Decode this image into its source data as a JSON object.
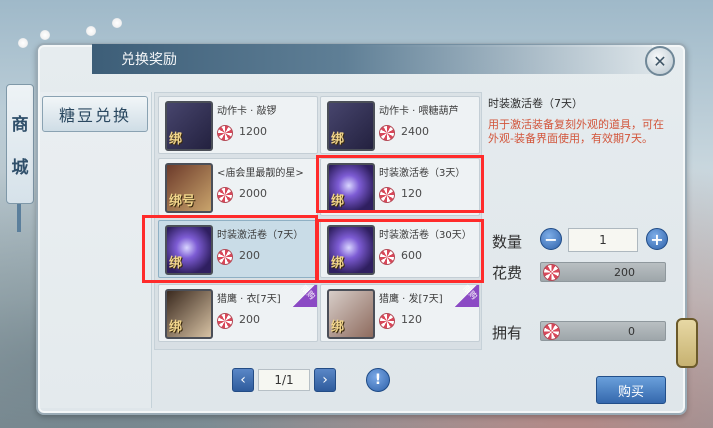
{
  "window": {
    "title": "兑换奖励",
    "close_symbol": "✕"
  },
  "side_banner": {
    "chars": [
      "商",
      "城"
    ]
  },
  "side_tab": {
    "label": "糖豆兑换"
  },
  "items": [
    {
      "name": "动作卡 · 敲锣",
      "price": "1200",
      "bind": "绑",
      "thumb": "book"
    },
    {
      "name": "动作卡 · 喂糖葫芦",
      "price": "2400",
      "bind": "绑",
      "thumb": "book"
    },
    {
      "name": "<庙会里最靓的星>",
      "price": "2000",
      "bind": "绑号",
      "thumb": "star"
    },
    {
      "name": "时装激活卷（3天）",
      "price": "120",
      "bind": "绑",
      "thumb": "scroll"
    },
    {
      "name": "时装激活卷（7天）",
      "price": "200",
      "bind": "绑",
      "thumb": "scroll",
      "selected": true
    },
    {
      "name": "时装激活卷（30天）",
      "price": "600",
      "bind": "绑",
      "thumb": "scroll"
    },
    {
      "name": "猎鹰 · 衣[7天]",
      "price": "200",
      "bind": "绑",
      "thumb": "hawk",
      "limited": "限购"
    },
    {
      "name": "猎鹰 · 发[7天]",
      "price": "120",
      "bind": "绑",
      "thumb": "hair",
      "limited": "限购"
    }
  ],
  "pagination": {
    "page": "1/1",
    "prev": "‹",
    "next": "›",
    "info": "!"
  },
  "detail": {
    "title": "时装激活卷（7天）",
    "description": "用于激活装备复刻外观的道具，可在外观-装备界面使用，有效期7天。",
    "qty_label": "数量",
    "qty_value": "1",
    "minus": "−",
    "plus": "+",
    "cost_label": "花费",
    "cost_value": "200",
    "own_label": "拥有",
    "own_value": "0",
    "buy_label": "购买"
  },
  "colors": {
    "highlight": "#ff2b2b",
    "accent_blue": "#3568ad",
    "desc_red": "#d2553b"
  }
}
